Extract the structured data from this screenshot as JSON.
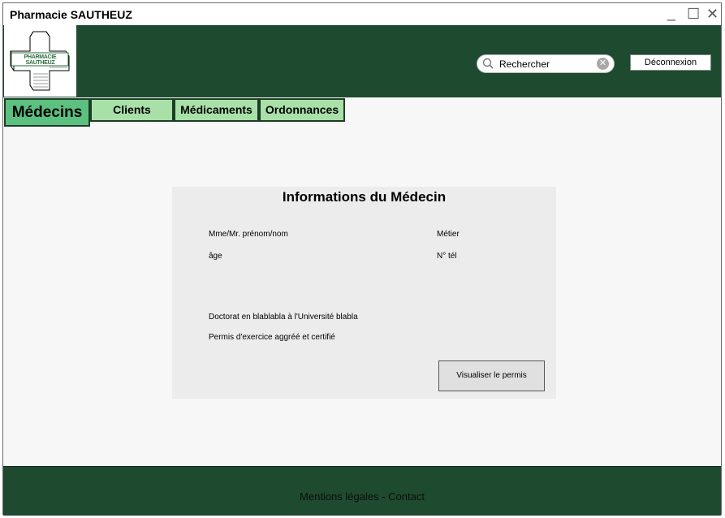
{
  "window": {
    "title": "Pharmacie SAUTHEUZ"
  },
  "logo": {
    "text": "PHARMACIE SAUTHEUZ"
  },
  "header": {
    "search_value": "Rechercher",
    "logout_label": "Déconnexion"
  },
  "nav": {
    "tabs": [
      {
        "label": "Médecins",
        "active": true
      },
      {
        "label": "Clients"
      },
      {
        "label": "Médicaments"
      },
      {
        "label": "Ordonnances"
      }
    ]
  },
  "doctor": {
    "section_title": "Informations du Médecin",
    "name": "Mme/Mr. prénom/nom",
    "age": "âge",
    "job": "Métier",
    "phone": "N° tél",
    "education": "Doctorat en blablabla à l'Université blabla",
    "license": "Permis d'exercice aggréé et certifié",
    "view_license_label": "Visualiser le permis"
  },
  "footer": {
    "text": "Mentions légales - Contact"
  },
  "colors": {
    "header_bg": "#1e4a30",
    "tab_bg": "#a8e0a8",
    "tab_active_bg": "#5cc080"
  }
}
